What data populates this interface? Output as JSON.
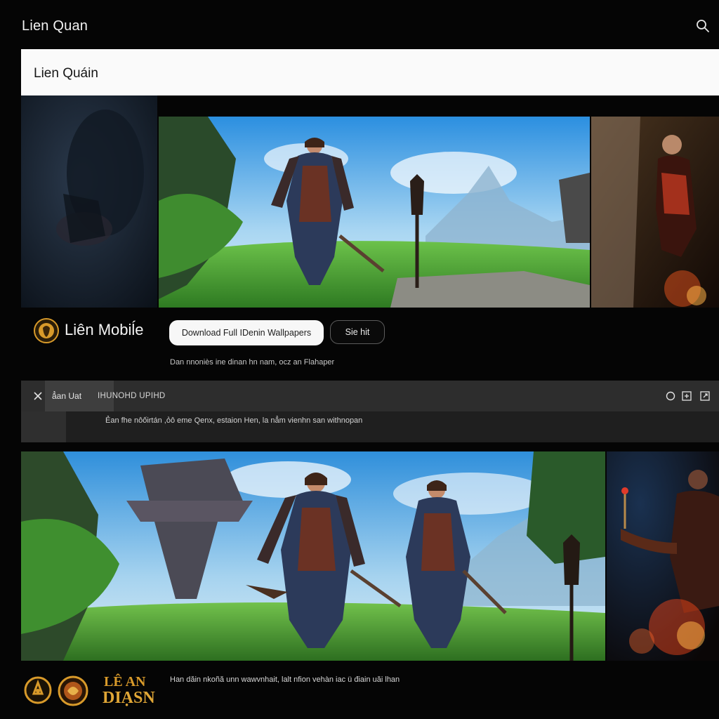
{
  "app": {
    "title": "Lien Quan"
  },
  "header": {
    "title": "Lien Quáin"
  },
  "brand": {
    "name": "Liên Mobiĺe"
  },
  "actions": {
    "download_label": "Download Full IDenin Wallpapers",
    "site_label": "Sie hit"
  },
  "tagline": "Dan nnoniès ine dinan hn nam, ocz an Flahaper",
  "toolbar": {
    "tab_label": "ẳan Uat",
    "label": "IHUNOHD UPIHD",
    "subtitle": "Ẻan fhe nôốirtán ,ỏô eme Qenx, estaion Hen, la nẳm vienhn san withnopan"
  },
  "footer": {
    "wordmark_top": "LÊ AN",
    "wordmark_bottom": "DIẠSN",
    "text": "Han dăin nkoñă unn wawvnhait, lalt nfion vehàn iac ü điain uăi lhan"
  },
  "icons": {
    "search": "search-icon",
    "close": "close-icon",
    "circle": "circle-icon",
    "add": "add-box-icon",
    "export": "export-box-icon"
  },
  "colors": {
    "background": "#050505",
    "header_bg": "#fafafa",
    "toolbar_bg": "#2d2d2d",
    "gold": "#d89a2a"
  }
}
